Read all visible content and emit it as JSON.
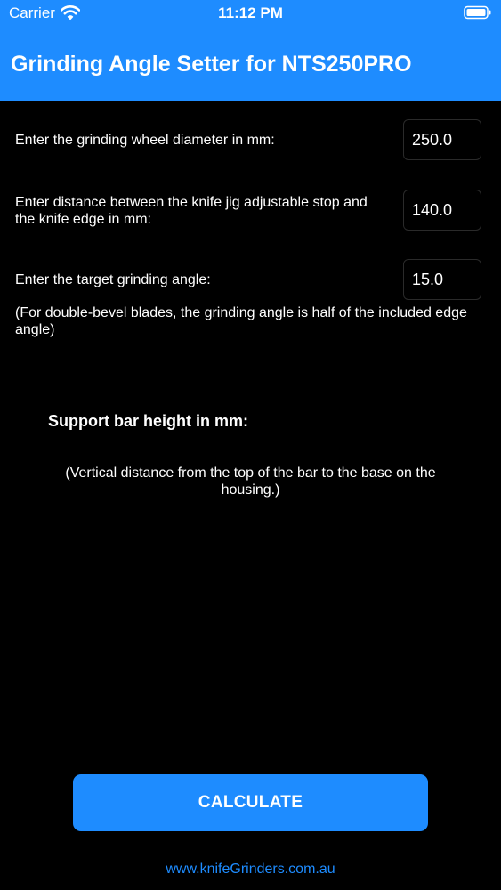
{
  "status_bar": {
    "carrier": "Carrier",
    "time": "11:12 PM"
  },
  "header": {
    "title": "Grinding Angle Setter for NTS250PRO"
  },
  "form": {
    "wheel_diameter": {
      "label": "Enter the grinding wheel diameter in mm:",
      "value": "250.0"
    },
    "stop_distance": {
      "label": "Enter distance between the knife jig adjustable stop and the knife edge in mm:",
      "value": "140.0"
    },
    "target_angle": {
      "label": "Enter the target grinding angle:",
      "value": "15.0"
    },
    "angle_note": "(For double-bevel blades, the grinding angle is half of the included edge angle)"
  },
  "result": {
    "heading": "Support bar height in mm:",
    "note": "(Vertical distance from the top of the bar to the base on the housing.)"
  },
  "actions": {
    "calculate_label": "CALCULATE"
  },
  "footer": {
    "link_text": "www.knifeGrinders.com.au"
  },
  "colors": {
    "accent": "#1e8cff",
    "background": "#000000",
    "text": "#ffffff"
  },
  "icons": [
    "wifi-icon",
    "battery-icon"
  ]
}
